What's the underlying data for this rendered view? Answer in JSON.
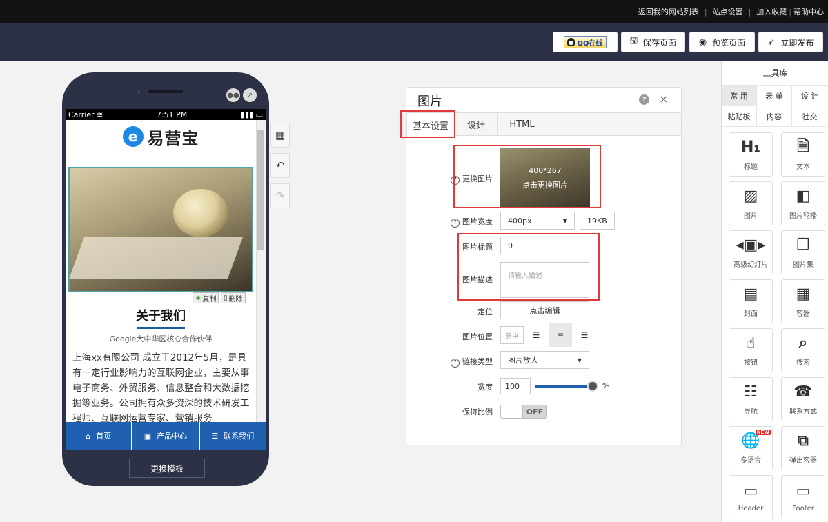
{
  "topbar": {
    "links": [
      "返回我的网站列表",
      "站点设置",
      "加入收藏",
      "帮助中心"
    ],
    "separator": "|"
  },
  "header": {
    "qq_label": "QQ在线",
    "save_label": "保存页面",
    "preview_label": "预览页面",
    "publish_label": "立即发布"
  },
  "phone": {
    "carrier": "Carrier",
    "time": "7:51 PM",
    "logo_letter": "e",
    "logo_text": "易营宝",
    "copy_label": "复制",
    "delete_label": "删除",
    "about_title": "关于我们",
    "about_subtitle": "Google大中华区核心合作伙伴",
    "about_text": "上海xx有限公司 成立于2012年5月，是具有一定行业影响力的互联网企业，主要从事电子商务、外贸服务、信息整合和大数据挖掘等业务。公司拥有众多资深的技术研发工程师、互联网运营专家、营销服务",
    "nav": [
      "首页",
      "产品中心",
      "联系我们"
    ],
    "change_template": "更换模板"
  },
  "panel": {
    "title": "图片",
    "help": "?",
    "close": "×",
    "tabs": [
      "基本设置",
      "设计",
      "HTML"
    ],
    "active_tab": "基本设置",
    "fields": {
      "replace_image_label": "更换图片",
      "image_dims": "400*267",
      "image_action": "点击更换图片",
      "width_label": "图片宽度",
      "width_value": "400px",
      "file_size": "19KB",
      "title_label": "图片标题",
      "title_value": "0",
      "desc_label": "图片描述",
      "desc_placeholder": "请输入描述",
      "position_label": "定位",
      "position_button": "点击编辑",
      "align_label": "图片位置",
      "align_value": "居中",
      "link_label": "链接类型",
      "link_value": "图片放大",
      "scale_label": "宽度",
      "scale_value": "100",
      "scale_unit": "%",
      "ratio_label": "保持比例",
      "ratio_state": "OFF"
    }
  },
  "toolbox": {
    "title": "工具库",
    "tabs": [
      "常 用",
      "表 单",
      "设 计",
      "粘贴板",
      "内容",
      "社交"
    ],
    "active_tab": "常 用",
    "tools": [
      {
        "label": "标题",
        "icon": "heading-icon"
      },
      {
        "label": "文本",
        "icon": "text-icon"
      },
      {
        "label": "图片",
        "icon": "image-icon"
      },
      {
        "label": "图片轮播",
        "icon": "carousel-icon"
      },
      {
        "label": "高级幻灯片",
        "icon": "slideshow-icon"
      },
      {
        "label": "图片集",
        "icon": "gallery-icon"
      },
      {
        "label": "封面",
        "icon": "cover-icon"
      },
      {
        "label": "容器",
        "icon": "container-icon"
      },
      {
        "label": "按钮",
        "icon": "button-icon"
      },
      {
        "label": "搜索",
        "icon": "search-icon"
      },
      {
        "label": "导航",
        "icon": "nav-icon"
      },
      {
        "label": "联系方式",
        "icon": "contact-icon"
      },
      {
        "label": "多语言",
        "icon": "globe-icon",
        "badge": "NEW"
      },
      {
        "label": "弹出容器",
        "icon": "popup-icon"
      },
      {
        "label": "Header",
        "icon": "header-icon"
      },
      {
        "label": "Footer",
        "icon": "footer-icon"
      }
    ]
  },
  "colors": {
    "header_bg": "#2c3145",
    "accent": "#2060b0",
    "highlight": "#e03a3a"
  }
}
